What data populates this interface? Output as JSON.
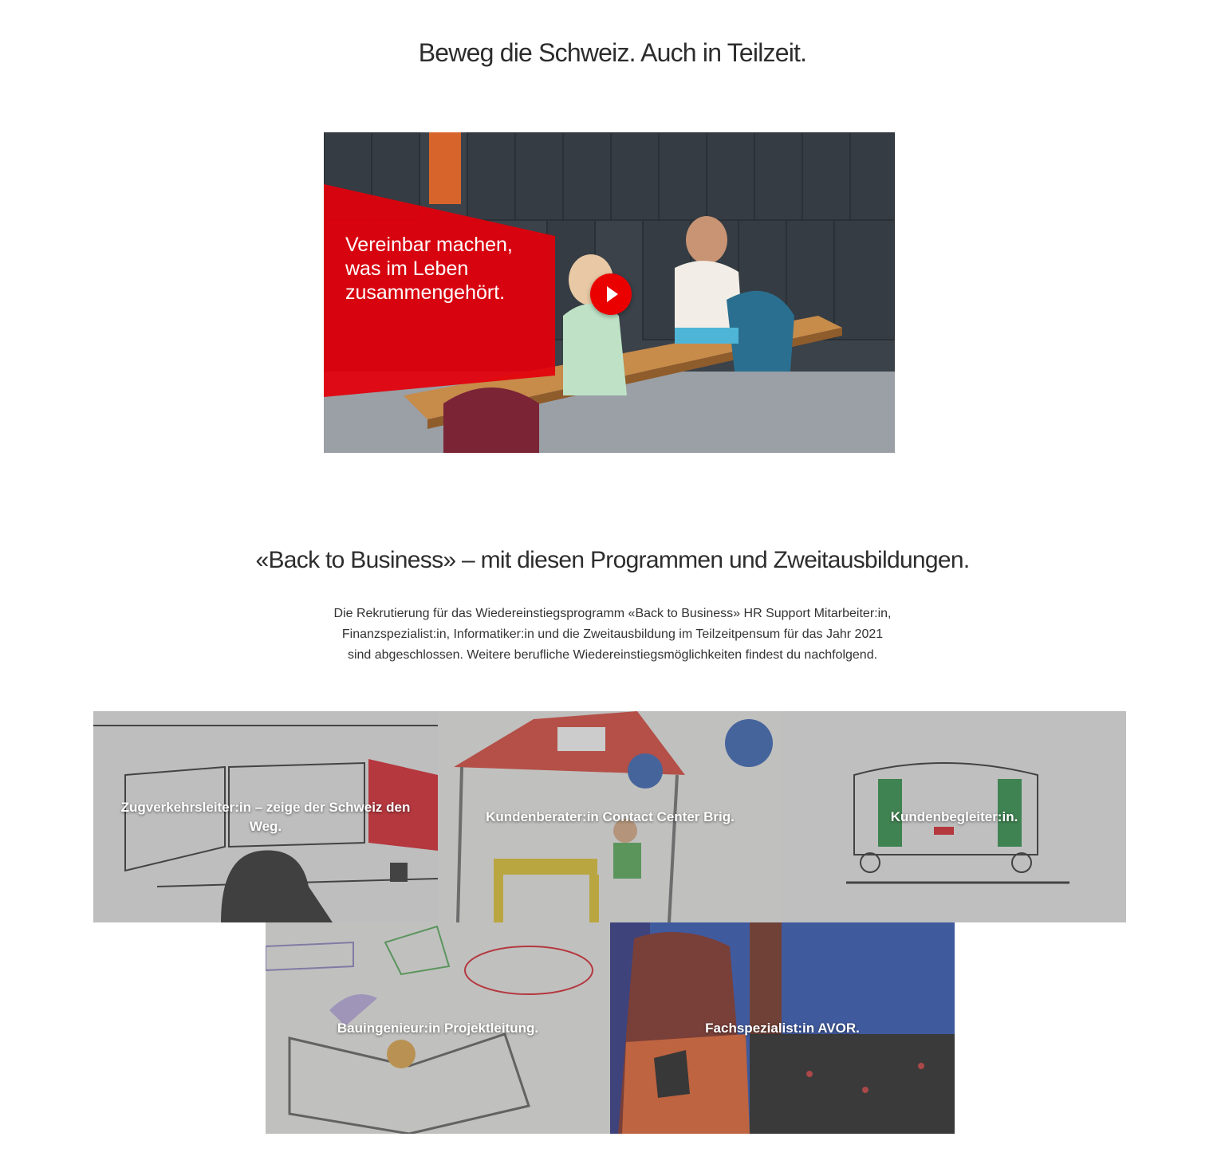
{
  "section1": {
    "title": "Beweg die Schweiz. Auch in Teilzeit."
  },
  "video": {
    "overlay_lines": [
      "Vereinbar machen,",
      "was im Leben",
      "zusammengehört."
    ],
    "play_icon": "play-icon",
    "accent_color": "#eb0000"
  },
  "section2": {
    "title": "«Back to Business» – mit diesen Programmen und Zweitausbildungen.",
    "intro": "Die Rekrutierung für das Wiedereinstiegsprogramm «Back to Business» HR Support Mitarbeiter:in, Finanzspezialist:in, Informatiker:in und die Zweitausbildung im Teilzeitpensum für das Jahr 2021 sind abgeschlossen. Weitere berufliche Wiedereinstiegsmöglichkeiten findest du nachfolgend."
  },
  "tiles": [
    {
      "label": "Zugverkehrsleiter:in – zeige der Schweiz den Weg."
    },
    {
      "label": "Kundenberater:in Contact Center Brig."
    },
    {
      "label": "Kundenbegleiter:in."
    },
    {
      "label": "Bauingenieur:in Projektleitung."
    },
    {
      "label": "Fachspezialist:in AVOR."
    }
  ]
}
